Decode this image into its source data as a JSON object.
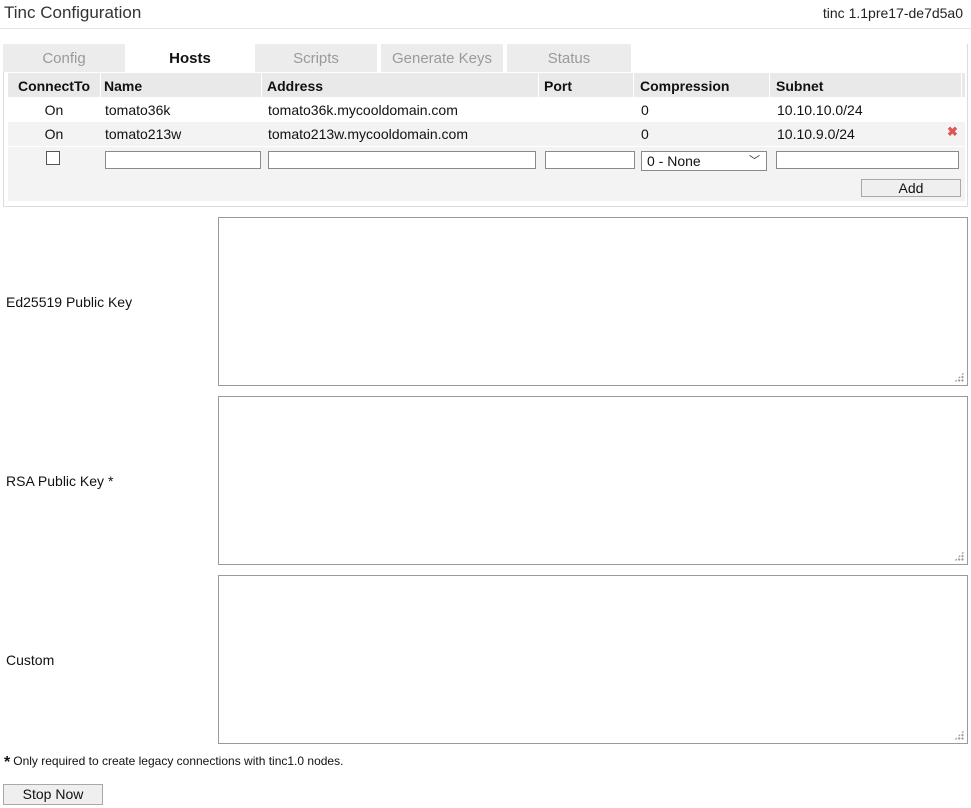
{
  "header": {
    "title": "Tinc Configuration",
    "version": "tinc 1.1pre17-de7d5a0"
  },
  "tabs": [
    {
      "label": "Config",
      "active": false
    },
    {
      "label": "Hosts",
      "active": true
    },
    {
      "label": "Scripts",
      "active": false
    },
    {
      "label": "Generate Keys",
      "active": false
    },
    {
      "label": "Status",
      "active": false
    }
  ],
  "hosts_table": {
    "columns": [
      "ConnectTo",
      "Name",
      "Address",
      "Port",
      "Compression",
      "Subnet"
    ],
    "rows": [
      {
        "connectto": "On",
        "name": "tomato36k",
        "address": "tomato36k.mycooldomain.com",
        "port": "",
        "compression": "0",
        "subnet": "10.10.10.0/24"
      },
      {
        "connectto": "On",
        "name": "tomato213w",
        "address": "tomato213w.mycooldomain.com",
        "port": "",
        "compression": "0",
        "subnet": "10.10.9.0/24"
      }
    ],
    "new_row": {
      "compression_selected": "0 - None"
    },
    "add_label": "Add",
    "delete_icon": "close-icon"
  },
  "fields": {
    "ed25519_label": "Ed25519 Public Key",
    "rsa_label": "RSA Public Key *",
    "custom_label": "Custom"
  },
  "footnote": {
    "star": "*",
    "text": "Only required to create legacy connections with tinc1.0 nodes."
  },
  "stop_button": "Stop Now"
}
